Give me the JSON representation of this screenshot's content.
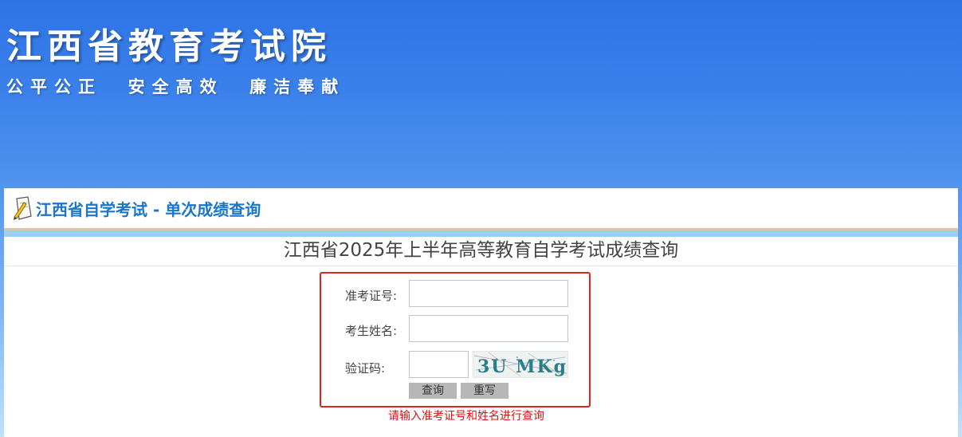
{
  "banner": {
    "org_name": "江西省教育考试院",
    "slogan": "公平公正  安全高效  廉洁奉献"
  },
  "panel": {
    "title": "江西省自学考试 - 单次成绩查询",
    "exam_title": "江西省2025年上半年高等教育自学考试成绩查询"
  },
  "form": {
    "ticket_label": "准考证号:",
    "ticket_value": "",
    "name_label": "考生姓名:",
    "name_value": "",
    "captcha_label": "验证码:",
    "captcha_value": "",
    "captcha_text": "3U MKg",
    "query_button": "查询",
    "reset_button": "重写"
  },
  "hint": "请输入准考证号和姓名进行查询",
  "colors": {
    "banner_top": "#2f73e6",
    "title_blue": "#1a76c9",
    "form_border": "#e32222",
    "hint_red": "#dd1111",
    "button_gray": "#b7b7b7"
  },
  "icons": [
    "pencil-paper-icon"
  ]
}
